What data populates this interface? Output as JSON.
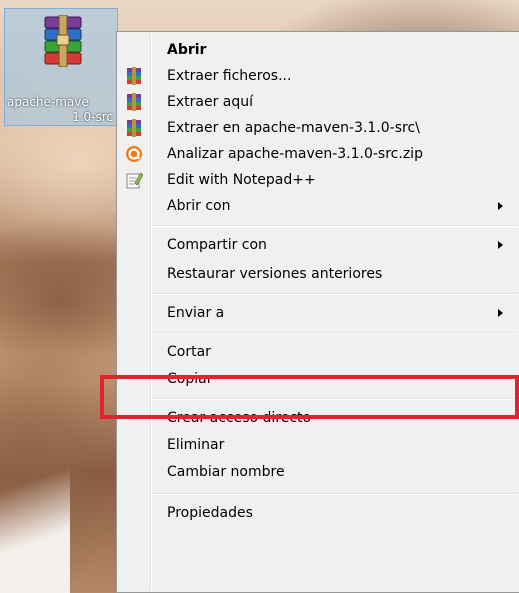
{
  "desktop": {
    "icon_label_line1": "apache-mave",
    "icon_label_line2": "1.0-src"
  },
  "context_menu": {
    "items": [
      {
        "label": "Abrir",
        "bold": true,
        "icon": "none",
        "submenu": false
      },
      {
        "label": "Extraer ficheros...",
        "icon": "winrar-icon",
        "submenu": false
      },
      {
        "label": "Extraer aquí",
        "icon": "winrar-icon",
        "submenu": false
      },
      {
        "label": "Extraer en apache-maven-3.1.0-src\\",
        "icon": "winrar-icon",
        "submenu": false
      },
      {
        "label": "Analizar apache-maven-3.1.0-src.zip",
        "icon": "avast-icon",
        "submenu": false
      },
      {
        "label": "Edit with Notepad++",
        "icon": "notepad-plus-plus-icon",
        "submenu": false
      },
      {
        "label": "Abrir con",
        "icon": "none",
        "submenu": true
      },
      {
        "label": "Compartir con",
        "icon": "none",
        "submenu": true
      },
      {
        "label": "Restaurar versiones anteriores",
        "icon": "none",
        "submenu": false
      },
      {
        "label": "Enviar a",
        "icon": "none",
        "submenu": true
      },
      {
        "label": "Cortar",
        "icon": "none",
        "submenu": false
      },
      {
        "label": "Copiar",
        "icon": "none",
        "submenu": false,
        "highlighted": true
      },
      {
        "label": "Crear acceso directo",
        "icon": "none",
        "submenu": false
      },
      {
        "label": "Eliminar",
        "icon": "none",
        "submenu": false
      },
      {
        "label": "Cambiar nombre",
        "icon": "none",
        "submenu": false
      },
      {
        "label": "Propiedades",
        "icon": "none",
        "submenu": false
      }
    ],
    "highlight_color": "#e2242e"
  }
}
